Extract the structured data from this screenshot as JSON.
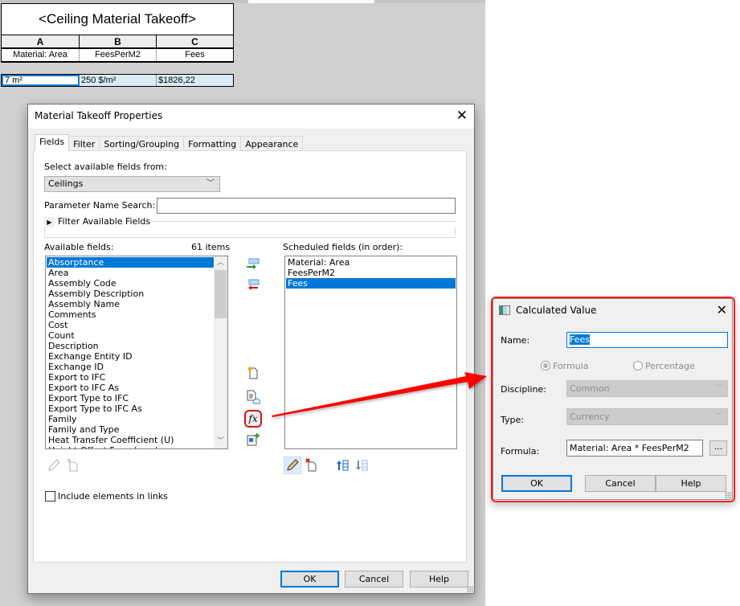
{
  "schedule": {
    "title": "<Ceiling Material Takeoff>",
    "column_letters": [
      "A",
      "B",
      "C"
    ],
    "column_headers": [
      "Material: Area",
      "FeesPerM2",
      "Fees"
    ],
    "rows": [
      [
        "7 m²",
        "250 $/m²",
        "$1826,22"
      ]
    ]
  },
  "material_takeoff_dialog": {
    "title": "Material Takeoff Properties",
    "tabs": [
      "Fields",
      "Filter",
      "Sorting/Grouping",
      "Formatting",
      "Appearance"
    ],
    "active_tab": "Fields",
    "select_fields_from_label": "Select available fields from:",
    "select_fields_from_value": "Ceilings",
    "parameter_search_label": "Parameter Name Search:",
    "parameter_search_value": "",
    "filter_available_fields_label": "Filter Available Fields",
    "available_fields_label": "Available fields:",
    "available_count": "61 items",
    "available_fields": [
      "Absorptance",
      "Area",
      "Assembly Code",
      "Assembly Description",
      "Assembly Name",
      "Comments",
      "Cost",
      "Count",
      "Description",
      "Exchange Entity ID",
      "Exchange ID",
      "Export to IFC",
      "Export to IFC As",
      "Export Type to IFC",
      "Export Type to IFC As",
      "Family",
      "Family and Type",
      "Heat Transfer Coefficient (U)",
      "Height Offset From Level"
    ],
    "available_selected": "Absorptance",
    "scheduled_fields_label": "Scheduled fields (in order):",
    "scheduled_fields": [
      "Material: Area",
      "FeesPerM2",
      "Fees"
    ],
    "scheduled_selected": "Fees",
    "include_links_label": "Include elements in links",
    "include_links_checked": false,
    "buttons": {
      "ok": "OK",
      "cancel": "Cancel",
      "help": "Help"
    },
    "icons": {
      "add_parameter": "add-to-scheduled-icon",
      "remove_parameter": "remove-from-scheduled-icon",
      "new_parameter": "new-parameter-icon",
      "add_shared": "shared-parameter-icon",
      "calculated": "fx",
      "combine": "combine-parameters-icon"
    }
  },
  "calculated_value_dialog": {
    "title": "Calculated Value",
    "name_label": "Name:",
    "name_value": "Fees",
    "radio_formula": "Formula",
    "radio_percentage": "Percentage",
    "selected_radio": "Formula",
    "discipline_label": "Discipline:",
    "discipline_value": "Common",
    "type_label": "Type:",
    "type_value": "Currency",
    "formula_label": "Formula:",
    "formula_value": "Material: Area * FeesPerM2",
    "browse_label": "...",
    "buttons": {
      "ok": "OK",
      "cancel": "Cancel",
      "help": "Help"
    }
  },
  "annotation": {
    "arrow_color": "#ff0000",
    "highlight_color": "#e01010"
  },
  "colors": {
    "selection": "#0078d7",
    "schedule_row_bg": "#d9ecf8",
    "background_gray": "#d0d0d0"
  }
}
